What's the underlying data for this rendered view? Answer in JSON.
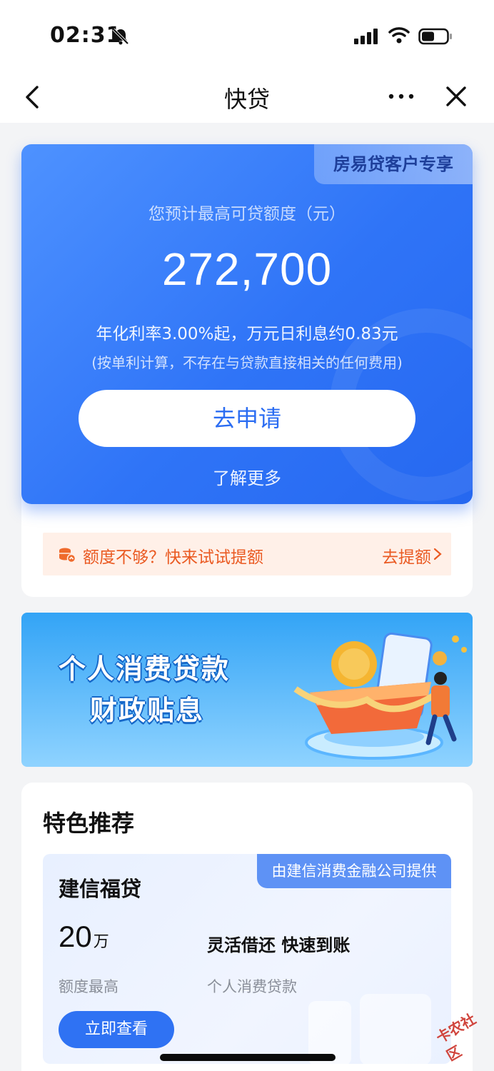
{
  "status_bar": {
    "time": "02:31"
  },
  "nav": {
    "title": "快贷"
  },
  "loan_card": {
    "badge": "房易贷客户专享",
    "amount_label": "您预计最高可贷额度（元）",
    "amount": "272,700",
    "rate_text": "年化利率3.00%起，万元日利息约0.83元",
    "rate_note": "(按单利计算，不存在与贷款直接相关的任何费用)",
    "apply_label": "去申请",
    "learn_more_label": "了解更多"
  },
  "tip": {
    "text": "额度不够？快来试试提额",
    "link": "去提额"
  },
  "banner": {
    "line1": "个人消费贷款",
    "line2": "财政贴息"
  },
  "feature": {
    "title": "特色推荐",
    "product": {
      "provider": "由建信消费金融公司提供",
      "name": "建信福贷",
      "quota_value": "20",
      "quota_unit": "万",
      "quota_label": "额度最高",
      "slogan": "灵活借还 快速到账",
      "slogan_sub": "个人消费贷款",
      "button_label": "立即查看"
    }
  },
  "watermark": {
    "text": "卡农社区"
  },
  "colors": {
    "primary": "#2f72f3",
    "tip_orange": "#ea5a22",
    "tip_bg": "#fff0e8"
  }
}
